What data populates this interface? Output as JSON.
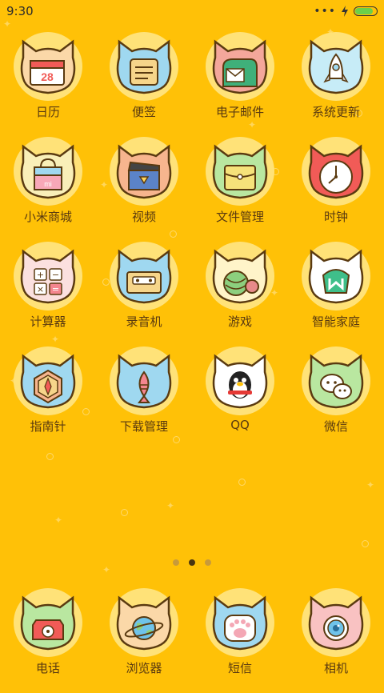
{
  "status_bar": {
    "time": "9:30",
    "signal_dots": "•••"
  },
  "apps": [
    [
      {
        "label": "日历",
        "icon": "calendar-icon",
        "cat_color": "#fbd8a8",
        "number": "28"
      },
      {
        "label": "便签",
        "icon": "notes-icon",
        "cat_color": "#9fd8f0"
      },
      {
        "label": "电子邮件",
        "icon": "mailbox-icon",
        "cat_color": "#f4a79b"
      },
      {
        "label": "系统更新",
        "icon": "rocket-icon",
        "cat_color": "#c7ecf7"
      }
    ],
    [
      {
        "label": "小米商城",
        "icon": "shopping-bag-icon",
        "cat_color": "#f9efb8",
        "tag": "mi"
      },
      {
        "label": "视频",
        "icon": "clapperboard-icon",
        "cat_color": "#f7b58e"
      },
      {
        "label": "文件管理",
        "icon": "folder-icon",
        "cat_color": "#b9e7a0"
      },
      {
        "label": "时钟",
        "icon": "clock-icon",
        "cat_color": "#f15b57"
      }
    ],
    [
      {
        "label": "计算器",
        "icon": "calculator-icon",
        "cat_color": "#fbe0df"
      },
      {
        "label": "录音机",
        "icon": "cassette-icon",
        "cat_color": "#9fd8f0"
      },
      {
        "label": "游戏",
        "icon": "yarn-ball-icon",
        "cat_color": "#fff4c9"
      },
      {
        "label": "智能家庭",
        "icon": "smart-home-icon",
        "cat_color": "#ffffff"
      }
    ],
    [
      {
        "label": "指南针",
        "icon": "compass-icon",
        "cat_color": "#9fd8f0"
      },
      {
        "label": "下载管理",
        "icon": "fish-download-icon",
        "cat_color": "#9fd8f0"
      },
      {
        "label": "QQ",
        "icon": "penguin-icon",
        "cat_color": "#ffffff"
      },
      {
        "label": "微信",
        "icon": "chat-bubbles-icon",
        "cat_color": "#b9e7a0"
      }
    ]
  ],
  "dock": [
    {
      "label": "电话",
      "icon": "phone-icon",
      "cat_color": "#b9e7a0"
    },
    {
      "label": "浏览器",
      "icon": "planet-icon",
      "cat_color": "#fbd8a8"
    },
    {
      "label": "短信",
      "icon": "paw-icon",
      "cat_color": "#9fd8f0"
    },
    {
      "label": "相机",
      "icon": "camera-eye-icon",
      "cat_color": "#f9c2c2"
    }
  ],
  "pager": {
    "pages": 3,
    "active_index": 1
  },
  "colors": {
    "background": "#ffc107",
    "label_text": "#5a3a10",
    "halo": "#ffe278"
  }
}
